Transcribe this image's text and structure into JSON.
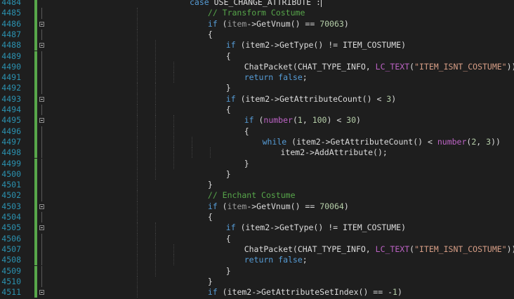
{
  "editor": {
    "first_line": 4484,
    "lines": [
      {
        "num": "4484",
        "indent": 0,
        "code": [
          {
            "t": "case ",
            "c": "k"
          },
          {
            "t": "USE_CHANGE_ATTRIBUTE",
            "c": "t"
          },
          {
            "t": " :",
            "c": "t"
          },
          {
            "t": "",
            "c": "cursor"
          }
        ]
      },
      {
        "num": "4485",
        "indent": 1,
        "code": [
          {
            "t": "// Transform Costume",
            "c": "c"
          }
        ]
      },
      {
        "num": "4486",
        "indent": 1,
        "code": [
          {
            "t": "if",
            "c": "k"
          },
          {
            "t": " (",
            "c": "t"
          },
          {
            "t": "item",
            "c": "g"
          },
          {
            "t": "->",
            "c": "t"
          },
          {
            "t": "GetVnum",
            "c": "t"
          },
          {
            "t": "() == ",
            "c": "t"
          },
          {
            "t": "70063",
            "c": "n"
          },
          {
            "t": ")",
            "c": "t"
          }
        ]
      },
      {
        "num": "4487",
        "indent": 1,
        "code": [
          {
            "t": "{",
            "c": "t"
          }
        ]
      },
      {
        "num": "4488",
        "indent": 2,
        "code": [
          {
            "t": "if",
            "c": "k"
          },
          {
            "t": " (item2->GetType() != ",
            "c": "t"
          },
          {
            "t": "ITEM_COSTUME",
            "c": "t"
          },
          {
            "t": ")",
            "c": "t"
          }
        ]
      },
      {
        "num": "4489",
        "indent": 2,
        "code": [
          {
            "t": "{",
            "c": "t"
          }
        ]
      },
      {
        "num": "4490",
        "indent": 3,
        "code": [
          {
            "t": "ChatPacket(",
            "c": "t"
          },
          {
            "t": "CHAT_TYPE_INFO",
            "c": "t"
          },
          {
            "t": ", ",
            "c": "t"
          },
          {
            "t": "LC_TEXT",
            "c": "m"
          },
          {
            "t": "(",
            "c": "t"
          },
          {
            "t": "\"ITEM_ISNT_COSTUME\"",
            "c": "s"
          },
          {
            "t": "));",
            "c": "t"
          }
        ]
      },
      {
        "num": "4491",
        "indent": 3,
        "code": [
          {
            "t": "return ",
            "c": "k"
          },
          {
            "t": "false",
            "c": "k"
          },
          {
            "t": ";",
            "c": "t"
          }
        ]
      },
      {
        "num": "4492",
        "indent": 2,
        "code": [
          {
            "t": "}",
            "c": "t"
          }
        ]
      },
      {
        "num": "4493",
        "indent": 2,
        "code": [
          {
            "t": "if",
            "c": "k"
          },
          {
            "t": " (item2->GetAttributeCount() < ",
            "c": "t"
          },
          {
            "t": "3",
            "c": "n"
          },
          {
            "t": ")",
            "c": "t"
          }
        ]
      },
      {
        "num": "4494",
        "indent": 2,
        "code": [
          {
            "t": "{",
            "c": "t"
          }
        ]
      },
      {
        "num": "4495",
        "indent": 3,
        "code": [
          {
            "t": "if",
            "c": "k"
          },
          {
            "t": " (",
            "c": "t"
          },
          {
            "t": "number",
            "c": "m"
          },
          {
            "t": "(",
            "c": "t"
          },
          {
            "t": "1",
            "c": "n"
          },
          {
            "t": ", ",
            "c": "t"
          },
          {
            "t": "100",
            "c": "n"
          },
          {
            "t": ") < ",
            "c": "t"
          },
          {
            "t": "30",
            "c": "n"
          },
          {
            "t": ")",
            "c": "t"
          }
        ]
      },
      {
        "num": "4496",
        "indent": 3,
        "code": [
          {
            "t": "{",
            "c": "t"
          }
        ]
      },
      {
        "num": "4497",
        "indent": 4,
        "code": [
          {
            "t": "while",
            "c": "k"
          },
          {
            "t": " (item2->GetAttributeCount() < ",
            "c": "t"
          },
          {
            "t": "number",
            "c": "m"
          },
          {
            "t": "(",
            "c": "t"
          },
          {
            "t": "2",
            "c": "n"
          },
          {
            "t": ", ",
            "c": "t"
          },
          {
            "t": "3",
            "c": "n"
          },
          {
            "t": "))",
            "c": "t"
          }
        ]
      },
      {
        "num": "4498",
        "indent": 5,
        "code": [
          {
            "t": "item2->AddAttribute();",
            "c": "t"
          }
        ]
      },
      {
        "num": "4499",
        "indent": 3,
        "code": [
          {
            "t": "}",
            "c": "t"
          }
        ]
      },
      {
        "num": "4500",
        "indent": 2,
        "code": [
          {
            "t": "}",
            "c": "t"
          }
        ]
      },
      {
        "num": "4501",
        "indent": 1,
        "code": [
          {
            "t": "}",
            "c": "t"
          }
        ]
      },
      {
        "num": "4502",
        "indent": 1,
        "code": [
          {
            "t": "// Enchant Costume",
            "c": "c"
          }
        ]
      },
      {
        "num": "4503",
        "indent": 1,
        "code": [
          {
            "t": "if",
            "c": "k"
          },
          {
            "t": " (",
            "c": "t"
          },
          {
            "t": "item",
            "c": "g"
          },
          {
            "t": "->",
            "c": "t"
          },
          {
            "t": "GetVnum",
            "c": "t"
          },
          {
            "t": "() == ",
            "c": "t"
          },
          {
            "t": "70064",
            "c": "n"
          },
          {
            "t": ")",
            "c": "t"
          }
        ]
      },
      {
        "num": "4504",
        "indent": 1,
        "code": [
          {
            "t": "{",
            "c": "t"
          }
        ]
      },
      {
        "num": "4505",
        "indent": 2,
        "code": [
          {
            "t": "if",
            "c": "k"
          },
          {
            "t": " (item2->GetType() != ",
            "c": "t"
          },
          {
            "t": "ITEM_COSTUME",
            "c": "t"
          },
          {
            "t": ")",
            "c": "t"
          }
        ]
      },
      {
        "num": "4506",
        "indent": 2,
        "code": [
          {
            "t": "{",
            "c": "t"
          }
        ]
      },
      {
        "num": "4507",
        "indent": 3,
        "code": [
          {
            "t": "ChatPacket(",
            "c": "t"
          },
          {
            "t": "CHAT_TYPE_INFO",
            "c": "t"
          },
          {
            "t": ", ",
            "c": "t"
          },
          {
            "t": "LC_TEXT",
            "c": "m"
          },
          {
            "t": "(",
            "c": "t"
          },
          {
            "t": "\"ITEM_ISNT_COSTUME\"",
            "c": "s"
          },
          {
            "t": "));",
            "c": "t"
          }
        ]
      },
      {
        "num": "4508",
        "indent": 3,
        "code": [
          {
            "t": "return ",
            "c": "k"
          },
          {
            "t": "false",
            "c": "k"
          },
          {
            "t": ";",
            "c": "t"
          }
        ]
      },
      {
        "num": "4509",
        "indent": 2,
        "code": [
          {
            "t": "}",
            "c": "t"
          }
        ]
      },
      {
        "num": "4510",
        "indent": 1,
        "code": [
          {
            "t": "}",
            "c": "t"
          }
        ]
      },
      {
        "num": "4511",
        "indent": 1,
        "code": [
          {
            "t": "if",
            "c": "k"
          },
          {
            "t": " (item2->GetAttributeSetIndex() == -",
            "c": "t"
          },
          {
            "t": "1",
            "c": "n"
          },
          {
            "t": ")",
            "c": "t"
          }
        ]
      }
    ],
    "fold_markers": [
      "4486",
      "4488",
      "4493",
      "4495",
      "4503",
      "4505",
      "4511"
    ],
    "colors": {
      "background": "#1e1e1e",
      "line_number": "#2b91af",
      "keyword": "#569cd6",
      "comment": "#57a64a",
      "string": "#d69d85",
      "macro": "#bd63c5",
      "number": "#b5cea8",
      "text": "#dcdcdc",
      "change_bar": "#57a64a"
    }
  }
}
